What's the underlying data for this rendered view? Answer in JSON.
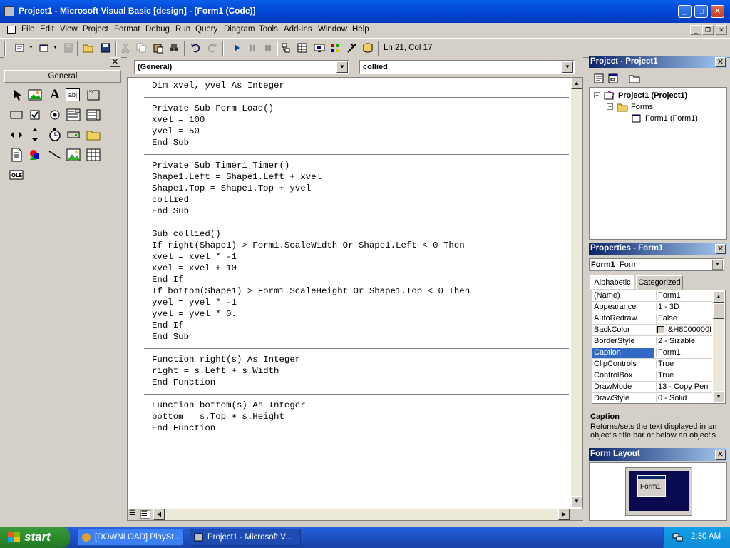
{
  "window": {
    "title": "Project1 - Microsoft Visual Basic [design] - [Form1 (Code)]",
    "controls": {
      "minimize": "_",
      "maximize": "□",
      "close": "✕"
    }
  },
  "menu": {
    "items": [
      "File",
      "Edit",
      "View",
      "Project",
      "Format",
      "Debug",
      "Run",
      "Query",
      "Diagram",
      "Tools",
      "Add-Ins",
      "Window",
      "Help"
    ]
  },
  "toolbar": {
    "position": "Ln 21, Col 17"
  },
  "toolbox": {
    "tab": "General",
    "close": "✕",
    "tool_label_glyph": "A",
    "textbox_glyph": "ab|"
  },
  "code_window": {
    "object_combo": "(General)",
    "procedure_combo": "collied",
    "lines": [
      "Dim xvel, yvel As Integer",
      "",
      "Private Sub Form_Load()",
      "xvel = 100",
      "yvel = 50",
      "End Sub",
      "",
      "Private Sub Timer1_Timer()",
      "Shape1.Left = Shape1.Left + xvel",
      "Shape1.Top = Shape1.Top + yvel",
      "collied",
      "End Sub",
      "",
      "Sub collied()",
      "If right(Shape1) > Form1.ScaleWidth Or Shape1.Left < 0 Then",
      "xvel = xvel * -1",
      "xvel = xvel + 10",
      "End If",
      "If bottom(Shape1) > Form1.ScaleHeight Or Shape1.Top < 0 Then",
      "yvel = yvel * -1",
      "yvel = yvel * 0.",
      "End If",
      "End Sub",
      "",
      "Function right(s) As Integer",
      "right = s.Left + s.Width",
      "End Function",
      "",
      "Function bottom(s) As Integer",
      "bottom = s.Top + s.Height",
      "End Function"
    ]
  },
  "project_panel": {
    "title": "Project - Project1",
    "close": "✕",
    "tree": {
      "project": "Project1 (Project1)",
      "forms_folder": "Forms",
      "form": "Form1 (Form1)"
    }
  },
  "properties_panel": {
    "title": "Properties - Form1",
    "close": "✕",
    "object": "Form1",
    "object_type": "Form",
    "tabs": [
      "Alphabetic",
      "Categorized"
    ],
    "rows": [
      {
        "name": "(Name)",
        "value": "Form1"
      },
      {
        "name": "Appearance",
        "value": "1 - 3D"
      },
      {
        "name": "AutoRedraw",
        "value": "False"
      },
      {
        "name": "BackColor",
        "value": "&H8000000F"
      },
      {
        "name": "BorderStyle",
        "value": "2 - Sizable"
      },
      {
        "name": "Caption",
        "value": "Form1"
      },
      {
        "name": "ClipControls",
        "value": "True"
      },
      {
        "name": "ControlBox",
        "value": "True"
      },
      {
        "name": "DrawMode",
        "value": "13 - Copy Pen"
      },
      {
        "name": "DrawStyle",
        "value": "0 - Solid"
      }
    ],
    "selected_row": "Caption",
    "description_title": "Caption",
    "description_text": "Returns/sets the text displayed in an object's title bar or below an object's"
  },
  "form_layout_panel": {
    "title": "Form Layout",
    "close": "✕",
    "form_label": "Form1"
  },
  "taskbar": {
    "start": "start",
    "tasks": [
      "[DOWNLOAD] PlaySt...",
      "Project1 - Microsoft V..."
    ],
    "clock": "2:30 AM"
  },
  "colors": {
    "titlebar": "#0046d4",
    "panel_active_title": "#0a246a",
    "selection": "#316ac5",
    "desktop_preview": "#0a0a50",
    "taskbar": "#245edb",
    "start_button": "#2f8f2f"
  }
}
